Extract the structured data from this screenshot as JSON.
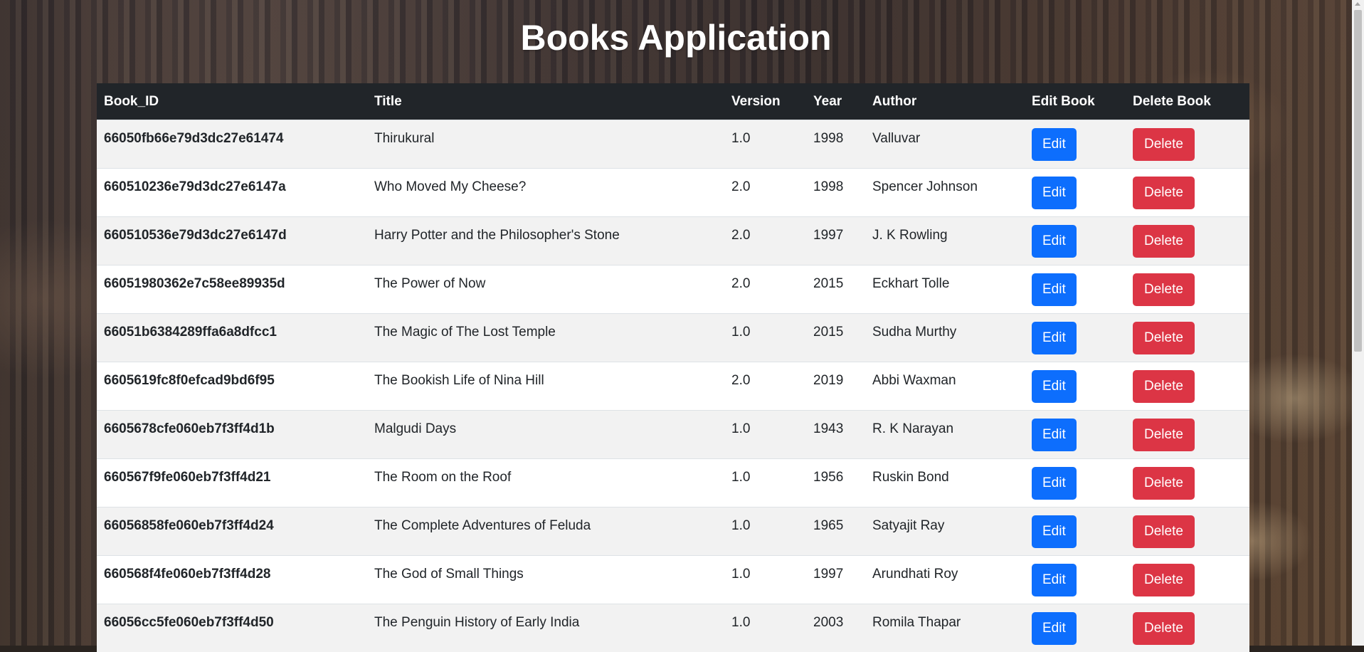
{
  "page": {
    "title": "Books Application"
  },
  "table": {
    "headers": [
      "Book_ID",
      "Title",
      "Version",
      "Year",
      "Author",
      "Edit Book",
      "Delete Book"
    ],
    "rows": [
      {
        "id": "66050fb66e79d3dc27e61474",
        "title": "Thirukural",
        "version": "1.0",
        "year": "1998",
        "author": "Valluvar",
        "edit": "Edit",
        "delete": "Delete"
      },
      {
        "id": "660510236e79d3dc27e6147a",
        "title": "Who Moved My Cheese?",
        "version": "2.0",
        "year": "1998",
        "author": "Spencer Johnson",
        "edit": "Edit",
        "delete": "Delete"
      },
      {
        "id": "660510536e79d3dc27e6147d",
        "title": "Harry Potter and the Philosopher's Stone",
        "version": "2.0",
        "year": "1997",
        "author": "J. K Rowling",
        "edit": "Edit",
        "delete": "Delete"
      },
      {
        "id": "66051980362e7c58ee89935d",
        "title": "The Power of Now",
        "version": "2.0",
        "year": "2015",
        "author": "Eckhart Tolle",
        "edit": "Edit",
        "delete": "Delete"
      },
      {
        "id": "66051b6384289ffa6a8dfcc1",
        "title": "The Magic of The Lost Temple",
        "version": "1.0",
        "year": "2015",
        "author": "Sudha Murthy",
        "edit": "Edit",
        "delete": "Delete"
      },
      {
        "id": "6605619fc8f0efcad9bd6f95",
        "title": "The Bookish Life of Nina Hill",
        "version": "2.0",
        "year": "2019",
        "author": "Abbi Waxman",
        "edit": "Edit",
        "delete": "Delete"
      },
      {
        "id": "6605678cfe060eb7f3ff4d1b",
        "title": "Malgudi Days",
        "version": "1.0",
        "year": "1943",
        "author": "R. K Narayan",
        "edit": "Edit",
        "delete": "Delete"
      },
      {
        "id": "660567f9fe060eb7f3ff4d21",
        "title": "The Room on the Roof",
        "version": "1.0",
        "year": "1956",
        "author": "Ruskin Bond",
        "edit": "Edit",
        "delete": "Delete"
      },
      {
        "id": "66056858fe060eb7f3ff4d24",
        "title": "The Complete Adventures of Feluda",
        "version": "1.0",
        "year": "1965",
        "author": "Satyajit Ray",
        "edit": "Edit",
        "delete": "Delete"
      },
      {
        "id": "660568f4fe060eb7f3ff4d28",
        "title": "The God of Small Things",
        "version": "1.0",
        "year": "1997",
        "author": "Arundhati Roy",
        "edit": "Edit",
        "delete": "Delete"
      },
      {
        "id": "66056cc5fe060eb7f3ff4d50",
        "title": "The Penguin History of Early India",
        "version": "1.0",
        "year": "2003",
        "author": "Romila Thapar",
        "edit": "Edit",
        "delete": "Delete"
      }
    ]
  },
  "colors": {
    "header_bg": "#212529",
    "edit_button": "#0d6efd",
    "delete_button": "#dc3545"
  }
}
